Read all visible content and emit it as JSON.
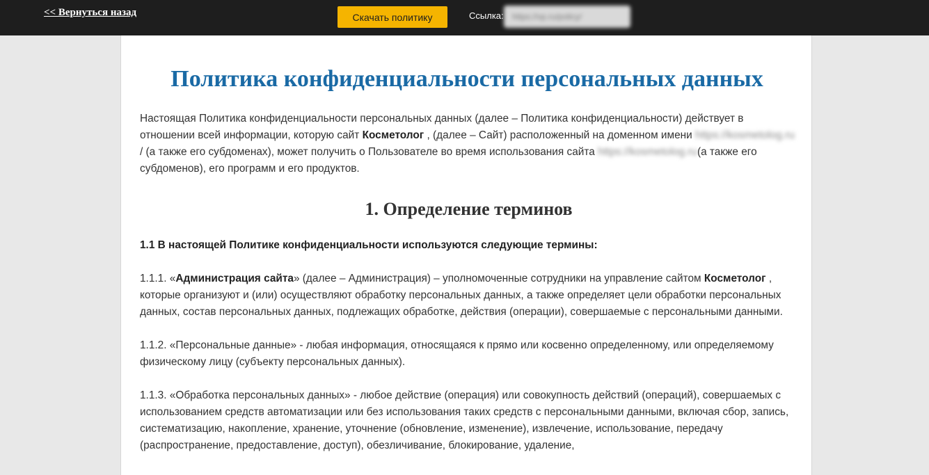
{
  "topbar": {
    "back_link": "<< Вернуться назад",
    "download_button": "Скачать политику",
    "link_label": "Ссылка:",
    "link_value": "https://vp.ru/policy/"
  },
  "page": {
    "title": "Политика конфиденциальности персональных данных",
    "intro": {
      "part1": "Настоящая Политика конфиденциальности персональных данных (далее – Политика конфиденциальности) действует в отношении всей информации, которую сайт ",
      "site_name": "Косметолог",
      "part2": " , (далее – Сайт) расположенный на доменном имени ",
      "domain1": "https://kosmetolog.ru",
      "part3": "/ (а также его субдоменах), может получить о Пользователе во время использования сайта ",
      "domain2": "https://kosmetolog.ru",
      "part4": "(а также его субдоменов), его программ и его продуктов."
    },
    "section1": {
      "title": "1. Определение терминов",
      "lead": "1.1 В настоящей Политике конфиденциальности используются следующие термины:",
      "t111_prefix": "1.1.1. «",
      "t111_term": "Администрация сайта",
      "t111_mid": "» (далее – Администрация) – уполномоченные сотрудники на управление сайтом ",
      "t111_site": "Косметолог",
      "t111_rest": " , которые организуют и (или) осуществляют обработку персональных данных, а также определяет цели обработки персональных данных, состав персональных данных, подлежащих обработке, действия (операции), совершаемые с персональными данными.",
      "t112": "1.1.2. «Персональные данные» - любая информация, относящаяся к прямо или косвенно определенному, или определяемому физическому лицу (субъекту персональных данных).",
      "t113": "1.1.3. «Обработка персональных данных» - любое действие (операция) или совокупность действий (операций), совершаемых с использованием средств автоматизации или без использования таких средств с персональными данными, включая сбор, запись, систематизацию, накопление, хранение, уточнение (обновление, изменение), извлечение, использование, передачу (распространение, предоставление, доступ), обезличивание, блокирование, удаление,"
    }
  }
}
